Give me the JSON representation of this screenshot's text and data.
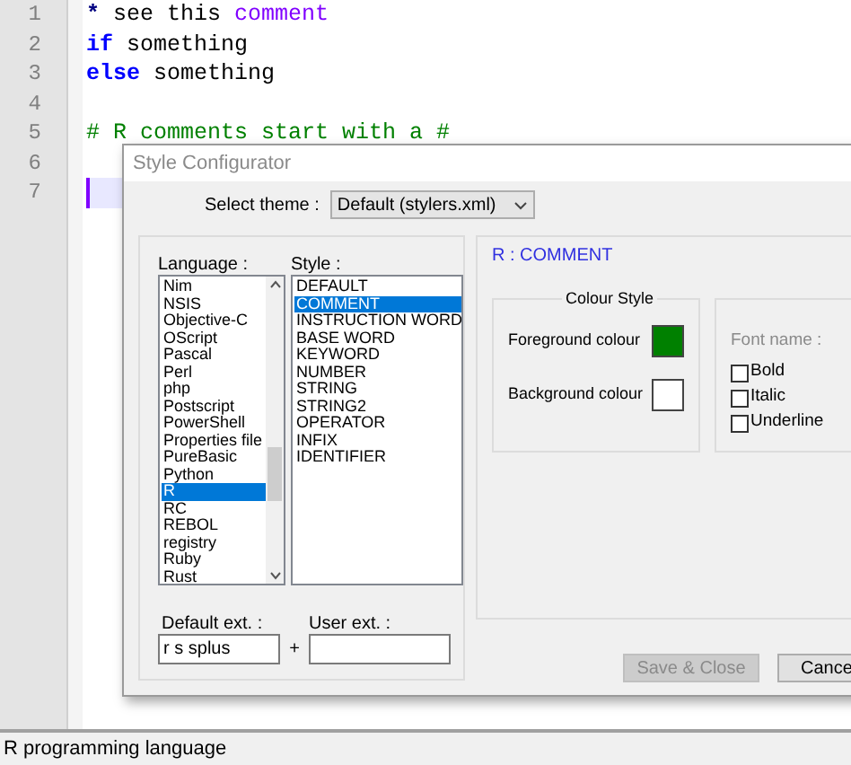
{
  "editor": {
    "lines": [
      {
        "number": "1",
        "current": false,
        "tokens": [
          {
            "text": "*",
            "kind": "operator"
          },
          {
            "text": " see this ",
            "kind": "plain"
          },
          {
            "text": "comment",
            "kind": "identifier"
          }
        ]
      },
      {
        "number": "2",
        "current": false,
        "tokens": [
          {
            "text": "if",
            "kind": "keyword"
          },
          {
            "text": " something",
            "kind": "plain"
          }
        ]
      },
      {
        "number": "3",
        "current": false,
        "tokens": [
          {
            "text": "else",
            "kind": "keyword"
          },
          {
            "text": " something",
            "kind": "plain"
          }
        ]
      },
      {
        "number": "4",
        "current": false
      },
      {
        "number": "5",
        "current": false,
        "tokens": [
          {
            "text": "# R comments start with a #",
            "kind": "comment"
          }
        ]
      },
      {
        "number": "6",
        "current": false
      },
      {
        "number": "7",
        "current": true
      }
    ]
  },
  "dialog": {
    "title": "Style Configurator",
    "theme_label": "Select theme :",
    "theme_value": "Default (stylers.xml)",
    "language_label": "Language :",
    "languages": [
      {
        "label": "Nim",
        "selected": false
      },
      {
        "label": "NSIS",
        "selected": false
      },
      {
        "label": "Objective-C",
        "selected": false
      },
      {
        "label": "OScript",
        "selected": false
      },
      {
        "label": "Pascal",
        "selected": false
      },
      {
        "label": "Perl",
        "selected": false
      },
      {
        "label": "php",
        "selected": false
      },
      {
        "label": "Postscript",
        "selected": false
      },
      {
        "label": "PowerShell",
        "selected": false
      },
      {
        "label": "Properties file",
        "selected": false
      },
      {
        "label": "PureBasic",
        "selected": false
      },
      {
        "label": "Python",
        "selected": false
      },
      {
        "label": "R",
        "selected": true
      },
      {
        "label": "RC",
        "selected": false
      },
      {
        "label": "REBOL",
        "selected": false
      },
      {
        "label": "registry",
        "selected": false
      },
      {
        "label": "Ruby",
        "selected": false
      },
      {
        "label": "Rust",
        "selected": false
      }
    ],
    "style_label": "Style :",
    "styles": [
      {
        "label": "DEFAULT",
        "selected": false
      },
      {
        "label": "COMMENT",
        "selected": true
      },
      {
        "label": "INSTRUCTION WORD",
        "selected": false
      },
      {
        "label": "BASE WORD",
        "selected": false
      },
      {
        "label": "KEYWORD",
        "selected": false
      },
      {
        "label": "NUMBER",
        "selected": false
      },
      {
        "label": "STRING",
        "selected": false
      },
      {
        "label": "STRING2",
        "selected": false
      },
      {
        "label": "OPERATOR",
        "selected": false
      },
      {
        "label": "INFIX",
        "selected": false
      },
      {
        "label": "IDENTIFIER",
        "selected": false
      }
    ],
    "default_ext_label": "Default ext. :",
    "default_ext_value": "r s splus",
    "plus": "+",
    "user_ext_label": "User ext. :",
    "style_heading": "R : COMMENT",
    "colour_group": "Colour Style",
    "colours": [
      {
        "label": "Foreground colour",
        "color": "#008000"
      },
      {
        "label": "Background colour",
        "color": "#ffffff"
      }
    ],
    "font_name_label": "Font name :",
    "font_options": [
      {
        "label": "Bold",
        "checked": false
      },
      {
        "label": "Italic",
        "checked": false
      },
      {
        "label": "Underline",
        "checked": false
      }
    ],
    "buttons": [
      {
        "label": "Save & Close",
        "disabled": true
      },
      {
        "label": "Cance",
        "disabled": false
      }
    ]
  },
  "status_bar": "R programming language"
}
